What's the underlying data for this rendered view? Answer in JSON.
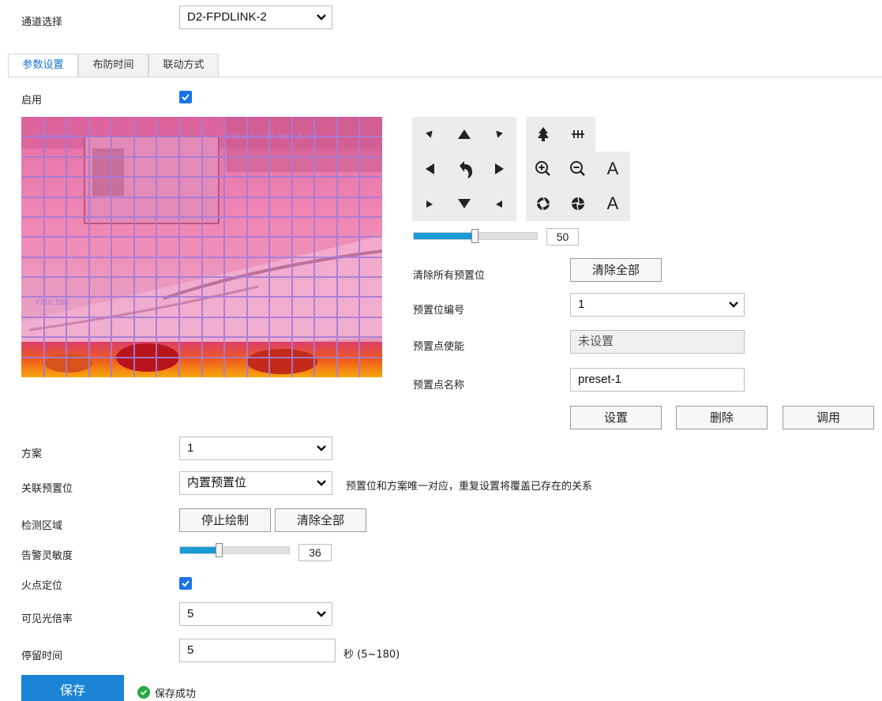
{
  "channel": {
    "label": "通道选择",
    "value": "D2-FPDLINK-2"
  },
  "tabs": [
    {
      "label": "参数设置",
      "active": true
    },
    {
      "label": "布防时间",
      "active": false
    },
    {
      "label": "联动方式",
      "active": false
    }
  ],
  "enable": {
    "label": "启用",
    "checked": true
  },
  "video": {
    "overlay_top_left": "IPCamera",
    "overlay_top_right": "2021-01-22 09:18:13",
    "overlay_mid_left": "FPDLINK"
  },
  "ptz": {
    "speed_value": "50",
    "speed_fraction": 0.5,
    "icons": [
      "up-left-arrow-icon",
      "up-arrow-icon",
      "up-right-arrow-icon",
      "left-arrow-icon",
      "return-icon",
      "right-arrow-icon",
      "down-left-arrow-icon",
      "down-arrow-icon",
      "down-right-arrow-icon",
      "wiper-icon",
      "light-icon",
      "zoom-in-icon",
      "zoom-out-icon",
      "focus-auto-icon",
      "iris-open-icon",
      "iris-close-icon",
      "iris-auto-icon"
    ],
    "focus_label": "A",
    "iris_label": "A"
  },
  "preset": {
    "clear_all_label": "清除所有预置位",
    "clear_all_button": "清除全部",
    "number_label": "预置位编号",
    "number_value": "1",
    "enable_label": "预置点使能",
    "enable_value": "未设置",
    "name_label": "预置点名称",
    "name_value": "preset-1",
    "set_button": "设置",
    "delete_button": "删除",
    "call_button": "调用"
  },
  "scheme": {
    "label": "方案",
    "value": "1"
  },
  "linked_preset": {
    "label": "关联预置位",
    "value": "内置预置位",
    "hint": "预置位和方案唯一对应，重复设置将覆盖已存在的关系"
  },
  "detect_area": {
    "label": "检测区域",
    "stop_button": "停止绘制",
    "clear_button": "清除全部"
  },
  "sensitivity": {
    "label": "告警灵敏度",
    "value": "36",
    "fraction": 0.36
  },
  "fire_locate": {
    "label": "火点定位",
    "checked": true
  },
  "visible_zoom": {
    "label": "可见光倍率",
    "value": "5"
  },
  "dwell": {
    "label": "停留时间",
    "value": "5",
    "unit": "秒  (5~180)"
  },
  "footer": {
    "save_button": "保存",
    "status": "保存成功"
  },
  "colors": {
    "accent": "#1a84d6",
    "checkbox": "#1a73e8",
    "slider": "#1a9ad6",
    "success": "#27a844",
    "grid": "#a77bd6"
  }
}
